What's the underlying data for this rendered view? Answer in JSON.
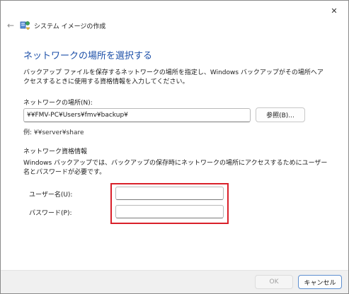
{
  "window": {
    "title": "システム イメージの作成",
    "close_symbol": "✕",
    "back_symbol": "←"
  },
  "page": {
    "heading": "ネットワークの場所を選択する",
    "description": "バックアップ ファイルを保存するネットワークの場所を指定し、Windows バックアップがその場所へアクセスするときに使用する資格情報を入力してください。"
  },
  "network_location": {
    "label": "ネットワークの場所(N):",
    "value": "¥¥FMV-PC¥Users¥fmv¥backup¥",
    "browse_label": "参照(B)...",
    "example": "例: ¥¥server¥share"
  },
  "credentials": {
    "section_label": "ネットワーク資格情報",
    "description": "Windows バックアップでは、バックアップの保存時にネットワークの場所にアクセスするためにユーザー名とパスワードが必要です。",
    "username_label": "ユーザー名(U):",
    "username_value": "",
    "password_label": "パスワード(P):",
    "password_value": ""
  },
  "footer": {
    "ok_label": "OK",
    "cancel_label": "キャンセル"
  },
  "colors": {
    "heading": "#1c4fa8",
    "highlight": "#d9202a",
    "footer_bg": "#f0f0f0"
  },
  "icons": {
    "close": "close-icon",
    "back": "back-arrow-icon",
    "app": "system-image-backup-icon"
  }
}
